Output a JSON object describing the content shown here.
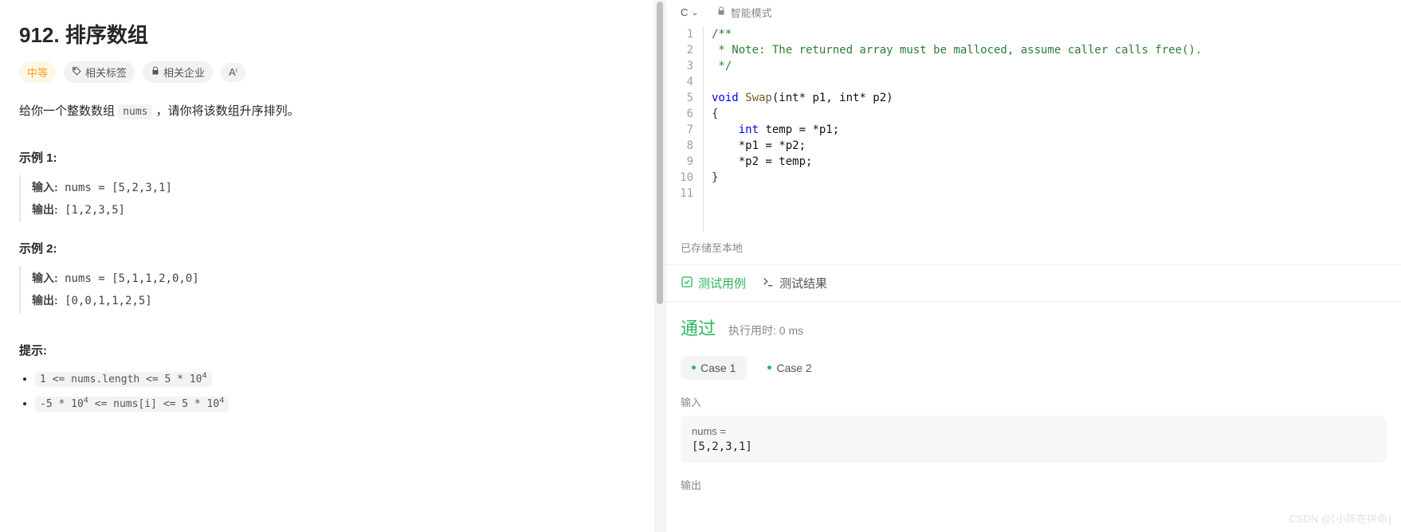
{
  "problem": {
    "title": "912. 排序数组",
    "difficulty": "中等",
    "related_tags": "相关标签",
    "related_companies": "相关企业",
    "hint_icon_label": "Aⁱ",
    "description_pre": "给你一个整数数组 ",
    "description_code": "nums",
    "description_post": " ，请你将该数组升序排列。",
    "example1_label": "示例 1:",
    "example1_input_label": "输入:",
    "example1_input_value": " nums = [5,2,3,1]",
    "example1_output_label": "输出:",
    "example1_output_value": " [1,2,3,5]",
    "example2_label": "示例 2:",
    "example2_input_label": "输入:",
    "example2_input_value": " nums = [5,1,1,2,0,0]",
    "example2_output_label": "输出:",
    "example2_output_value": " [0,0,1,1,2,5]",
    "hints_label": "提示:",
    "hint1_pre": "1 <= nums.length <= 5 * 10",
    "hint1_sup": "4",
    "hint2_pre": "-5 * 10",
    "hint2_sup1": "4",
    "hint2_mid": " <= nums[i] <= 5 * 10",
    "hint2_sup2": "4"
  },
  "editor": {
    "language": "C",
    "mode_label": "智能模式",
    "line_numbers": [
      "1",
      "2",
      "3",
      "4",
      "5",
      "6",
      "7",
      "8",
      "9",
      "10",
      "11"
    ],
    "code": {
      "l1": "/**",
      "l2": " * Note: The returned array must be malloced, assume caller calls free().",
      "l3": " */",
      "l4": "",
      "l5_kw": "void",
      "l5_fn": " Swap",
      "l5_rest": "(int* p1, int* p2)",
      "l6": "{",
      "l7_indent": "    ",
      "l7_kw": "int",
      "l7_rest": " temp = *p1;",
      "l8": "    *p1 = *p2;",
      "l9": "    *p2 = temp;",
      "l10": "}",
      "l11": ""
    },
    "save_status": "已存储至本地"
  },
  "results": {
    "tab_testcase": "测试用例",
    "tab_result": "测试结果",
    "status": "通过",
    "runtime_label": "执行用时: 0 ms",
    "case1": "Case 1",
    "case2": "Case 2",
    "input_label": "输入",
    "input_var": "nums =",
    "input_val": "[5,2,3,1]",
    "output_label": "输出"
  },
  "watermark": "CSDN @⌈小陈在拼命⌋"
}
